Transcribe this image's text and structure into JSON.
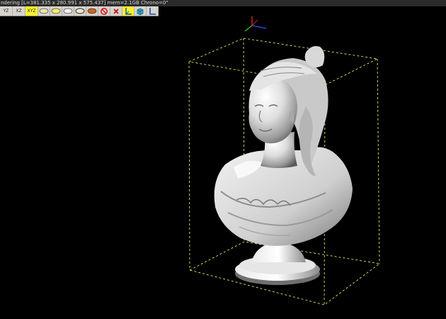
{
  "window": {
    "title": "ndering [L=381.335 x 280.991 x 575.437] mem=2.1GB Chrono=0\""
  },
  "toolbar": {
    "buttons": [
      {
        "label": "YZ",
        "active": false
      },
      {
        "label": "XZ",
        "active": false
      },
      {
        "label": "XYZ",
        "active": true
      }
    ],
    "icons": [
      "shaded-ellipse-icon",
      "flat-ellipse-icon",
      "wire-ellipse-icon",
      "outline-ellipse-icon",
      "textured-ellipse-icon",
      "no-entry-icon",
      "close-x-icon",
      "axes-icon",
      "cube-icon",
      "angle-tool-icon"
    ]
  },
  "viewport": {
    "background": "#000000",
    "bbox_color": "#e8e85a",
    "model": "marble-bust"
  },
  "colors": {
    "active_button": "#f7f32a",
    "toolbar_bg": "#d6d3ce",
    "axis_x": "#3a4cff",
    "axis_y": "#2ecc2e",
    "axis_z": "#ff2a2a"
  }
}
